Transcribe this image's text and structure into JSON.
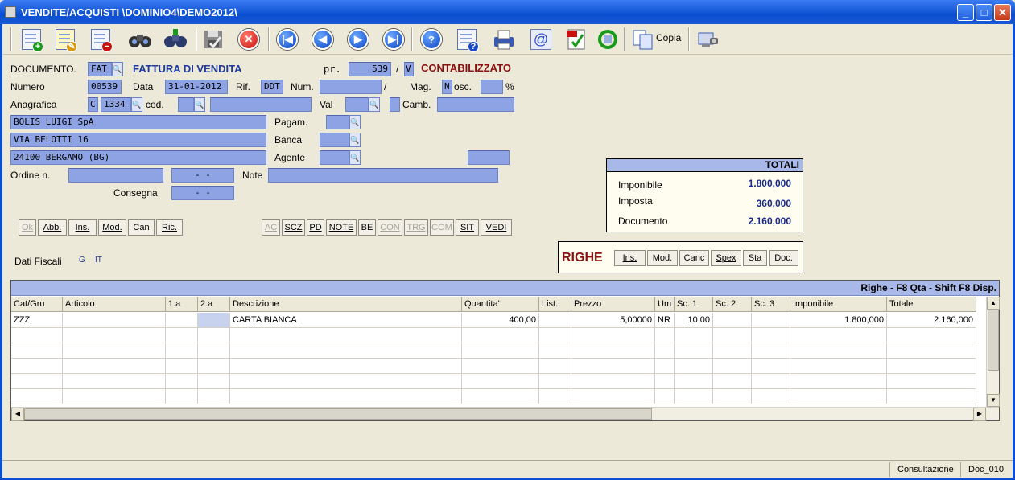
{
  "window": {
    "title": "VENDITE/ACQUISTI  \\DOMINIO4\\DEMO2012\\",
    "min_glyph": "_",
    "max_glyph": "□",
    "close_glyph": "✕"
  },
  "toolbar": {
    "copia_label": "Copia"
  },
  "form": {
    "documento_label": "DOCUMENTO.",
    "documento_code": "FAT",
    "documento_desc": "FATTURA DI VENDITA",
    "pr_label": "pr.",
    "pr_value": "539",
    "slash": "/",
    "pr_suffix": "V",
    "stato": "CONTABILIZZATO",
    "numero_label": "Numero",
    "numero_value": "00539",
    "data_label": "Data",
    "data_value": "31-01-2012",
    "rif_label": "Rif.",
    "rif_value": "DDT",
    "num_label": "Num.",
    "num_value": "",
    "num_slash": "/",
    "mag_label": "Mag.",
    "mag_value": "N",
    "osc_label": "osc.",
    "osc_value": "",
    "percent": "%",
    "anagrafica_label": "Anagrafica",
    "anagrafica_type": "C",
    "anagrafica_code": "1334",
    "cod_label": "cod.",
    "cod_value": "",
    "cod_desc": "",
    "val_label": "Val",
    "val_value": "",
    "camb_label": "Camb.",
    "camb_value": "",
    "rag_sociale": "BOLIS LUIGI SpA",
    "indirizzo": "VIA BELOTTI 16",
    "localita": "24100 BERGAMO (BG)",
    "pagam_label": "Pagam.",
    "banca_label": "Banca",
    "agente_label": "Agente",
    "ordine_label": "Ordine n.",
    "ordine_value": "",
    "ordine_data": "-  -",
    "note_label": "Note",
    "note_value": "",
    "consegna_label": "Consegna",
    "consegna_data": "-  -",
    "dati_fiscali_label": "Dati Fiscali",
    "dati_fiscali_g": "G",
    "dati_fiscali_it": "IT"
  },
  "buttons_left": [
    "Ok",
    "Abb.",
    "Ins.",
    "Mod.",
    "Can",
    "Ric."
  ],
  "buttons_right": [
    "AC",
    "SCZ",
    "PD",
    "NOTE",
    "BE",
    "CON",
    "TRG",
    "COM",
    "SIT",
    "VEDI"
  ],
  "totali": {
    "title": "TOTALI",
    "imponibile_label": "Imponibile",
    "imponibile_value": "1.800,000",
    "imposta_label": "Imposta",
    "imposta_value": "360,000",
    "documento_label": "Documento",
    "documento_value": "2.160,000"
  },
  "righe": {
    "label": "RIGHE",
    "buttons": [
      "Ins.",
      "Mod.",
      "Canc",
      "Spex",
      "Sta",
      "Doc."
    ]
  },
  "grid": {
    "title": "Righe - F8 Qta - Shift F8 Disp.",
    "columns": [
      "Cat/Gru",
      "Articolo",
      "1.a",
      "2.a",
      "Descrizione",
      "Quantita'",
      "List.",
      "Prezzo",
      "Um",
      "Sc. 1",
      "Sc. 2",
      "Sc. 3",
      "Imponibile",
      "Totale"
    ],
    "rows": [
      [
        "ZZZ.",
        "",
        "",
        "",
        "CARTA BIANCA",
        "400,00",
        "",
        "5,00000",
        "NR",
        "10,00",
        "",
        "",
        "1.800,000",
        "2.160,000"
      ]
    ]
  },
  "status": {
    "mode": "Consultazione",
    "doc": "Doc_010"
  }
}
